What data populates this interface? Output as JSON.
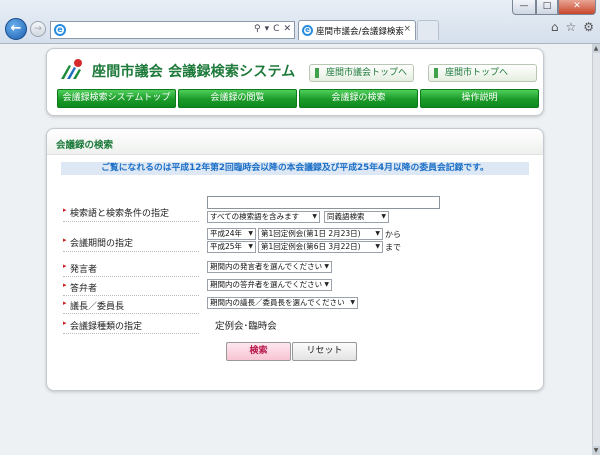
{
  "browser": {
    "tab_title": "座間市議会/会議録検索シ...",
    "tab_close": "×",
    "back_glyph": "←",
    "forward_glyph": "→",
    "address_tools": [
      "⚲",
      "▾",
      "C",
      "✕"
    ],
    "window_buttons": [
      "—",
      "□",
      "✕"
    ],
    "toolbar_icons": [
      "⌂",
      "☆",
      "⚙"
    ]
  },
  "header": {
    "site_title": "座間市議会 会議録検索システム",
    "links": [
      {
        "label": "座間市議会トップへ"
      },
      {
        "label": "座間市トップへ"
      }
    ],
    "nav": [
      "会議録検索システムトップ",
      "会議録の閲覧",
      "会議録の検索",
      "操作説明"
    ]
  },
  "search": {
    "section_title": "会議録の検索",
    "notice": "ご覧になれるのは平成12年第2回臨時会以降の本会議録及び平成25年4月以降の委員会記録です。",
    "labels": {
      "keyword": "検索語と検索条件の指定",
      "period": "会議期間の指定",
      "speaker": "発言者",
      "answerer": "答弁者",
      "chair": "議長／委員長",
      "kind": "会議録種類の指定"
    },
    "keyword_value": "",
    "keyword_condition": "すべての検索語を含みます",
    "synonym": "同義語検索",
    "period_from": {
      "year": "平成24年",
      "session": "第1回定例会(第1日 2月23日)",
      "suffix": "から"
    },
    "period_to": {
      "year": "平成25年",
      "session": "第1回定例会(第6日 3月22日)",
      "suffix": "まで"
    },
    "speaker_select": "期間内の発言者を選んでください",
    "answerer_select": "期間内の答弁者を選んでください",
    "chair_select": "期間内の議長／委員長を選んでください",
    "kinds_value": "定例会･臨時会",
    "search_button": "検索",
    "reset_button": "リセット"
  },
  "colors": {
    "brand_green": "#1d7a3a",
    "nav_green": "#1b9a2a",
    "notice_blue": "#1a6ec7",
    "search_pink": "#f8c4d4"
  }
}
